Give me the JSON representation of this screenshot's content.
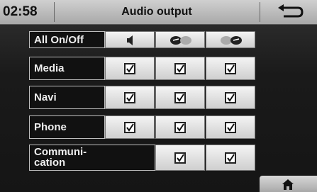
{
  "header": {
    "time": "02:58",
    "title": "Audio output"
  },
  "icons": {
    "back": "back-arrow-icon",
    "home": "home-icon",
    "speaker": "speaker-icon",
    "front_speakers": "front-speakers-icon",
    "rear_speakers": "rear-speakers-icon"
  },
  "all_toggle": {
    "label": "All On/Off"
  },
  "rows": [
    {
      "label": "Media",
      "checks": [
        true,
        true,
        true
      ]
    },
    {
      "label": "Navi",
      "checks": [
        true,
        true,
        true
      ]
    },
    {
      "label": "Phone",
      "checks": [
        true,
        true,
        true
      ]
    },
    {
      "label": "Communi-\ncation",
      "checks": [
        null,
        true,
        true
      ]
    }
  ],
  "colors": {
    "background": "#141414",
    "header": "#bcbcbc"
  }
}
